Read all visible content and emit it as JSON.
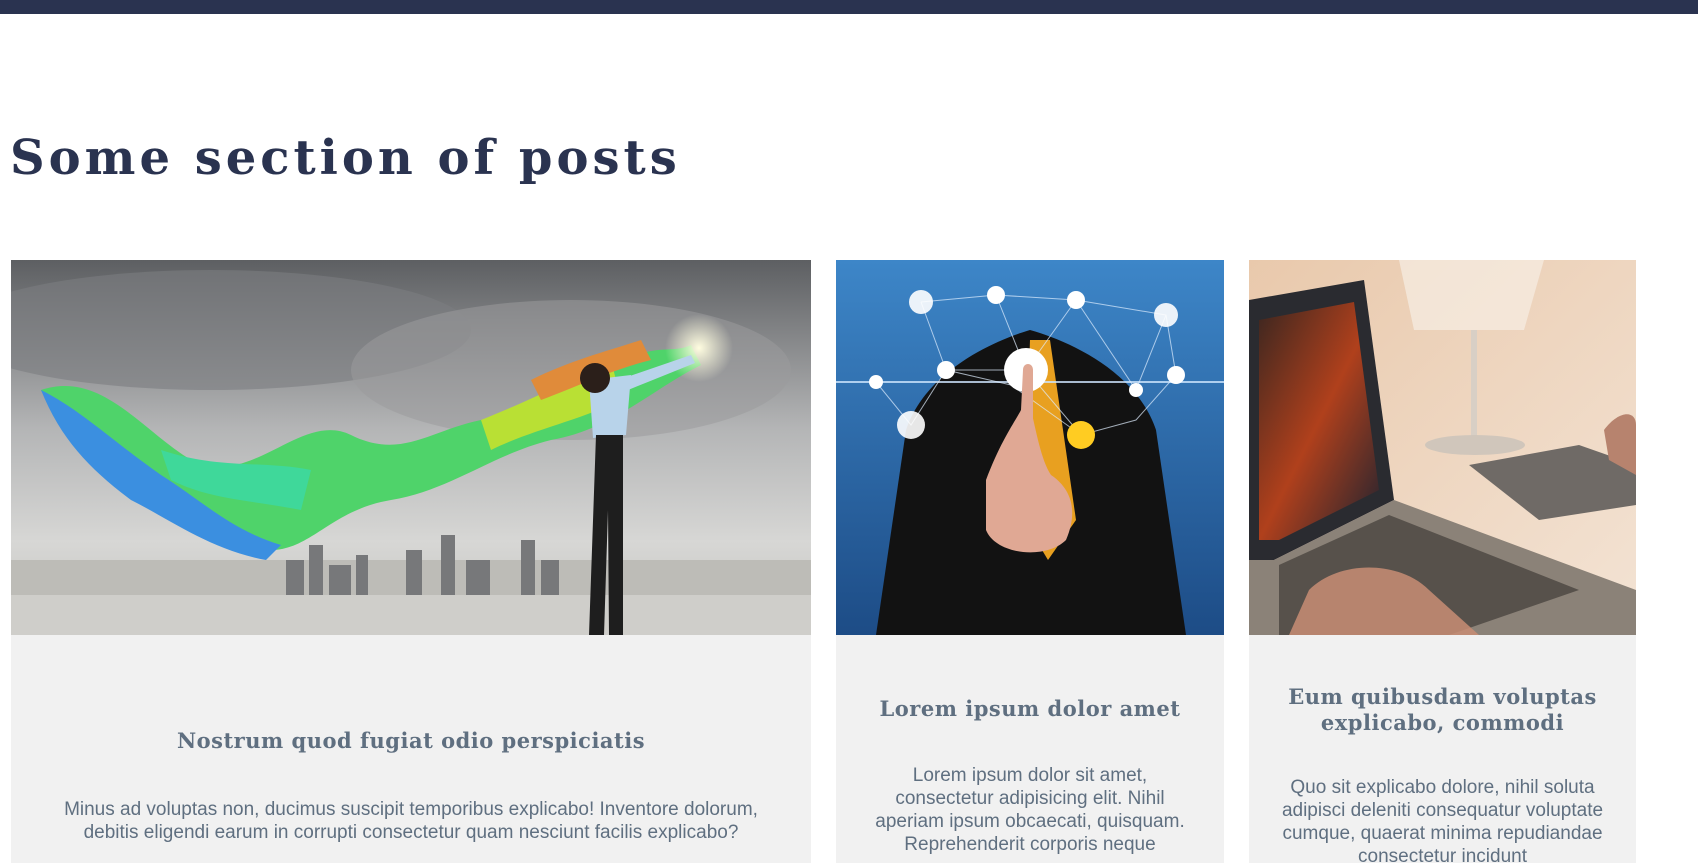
{
  "section": {
    "title": "Some section of posts"
  },
  "posts": [
    {
      "title": "Nostrum quod fugiat odio perspiciatis",
      "excerpt": "Minus ad voluptas non, ducimus suscipit temporibus explicabo! Inventore dolorum, debitis eligendi earum in corrupti consectetur quam nesciunt facilis explicabo?"
    },
    {
      "title": "Lorem ipsum dolor amet",
      "excerpt": "Lorem ipsum dolor sit amet, consectetur adipisicing elit. Nihil aperiam ipsum obcaecati, quisquam. Reprehenderit corporis neque"
    },
    {
      "title": "Eum quibusdam voluptas explicabo, commodi",
      "excerpt": "Quo sit explicabo dolore, nihil soluta adipisci deleniti consequatur voluptate cumque, quaerat minima repudiandae consectetur incidunt"
    }
  ],
  "colors": {
    "topbar": "#2a3350",
    "title": "#2a3350",
    "card_bg": "#f1f1f1",
    "card_text": "#5f6f80"
  }
}
